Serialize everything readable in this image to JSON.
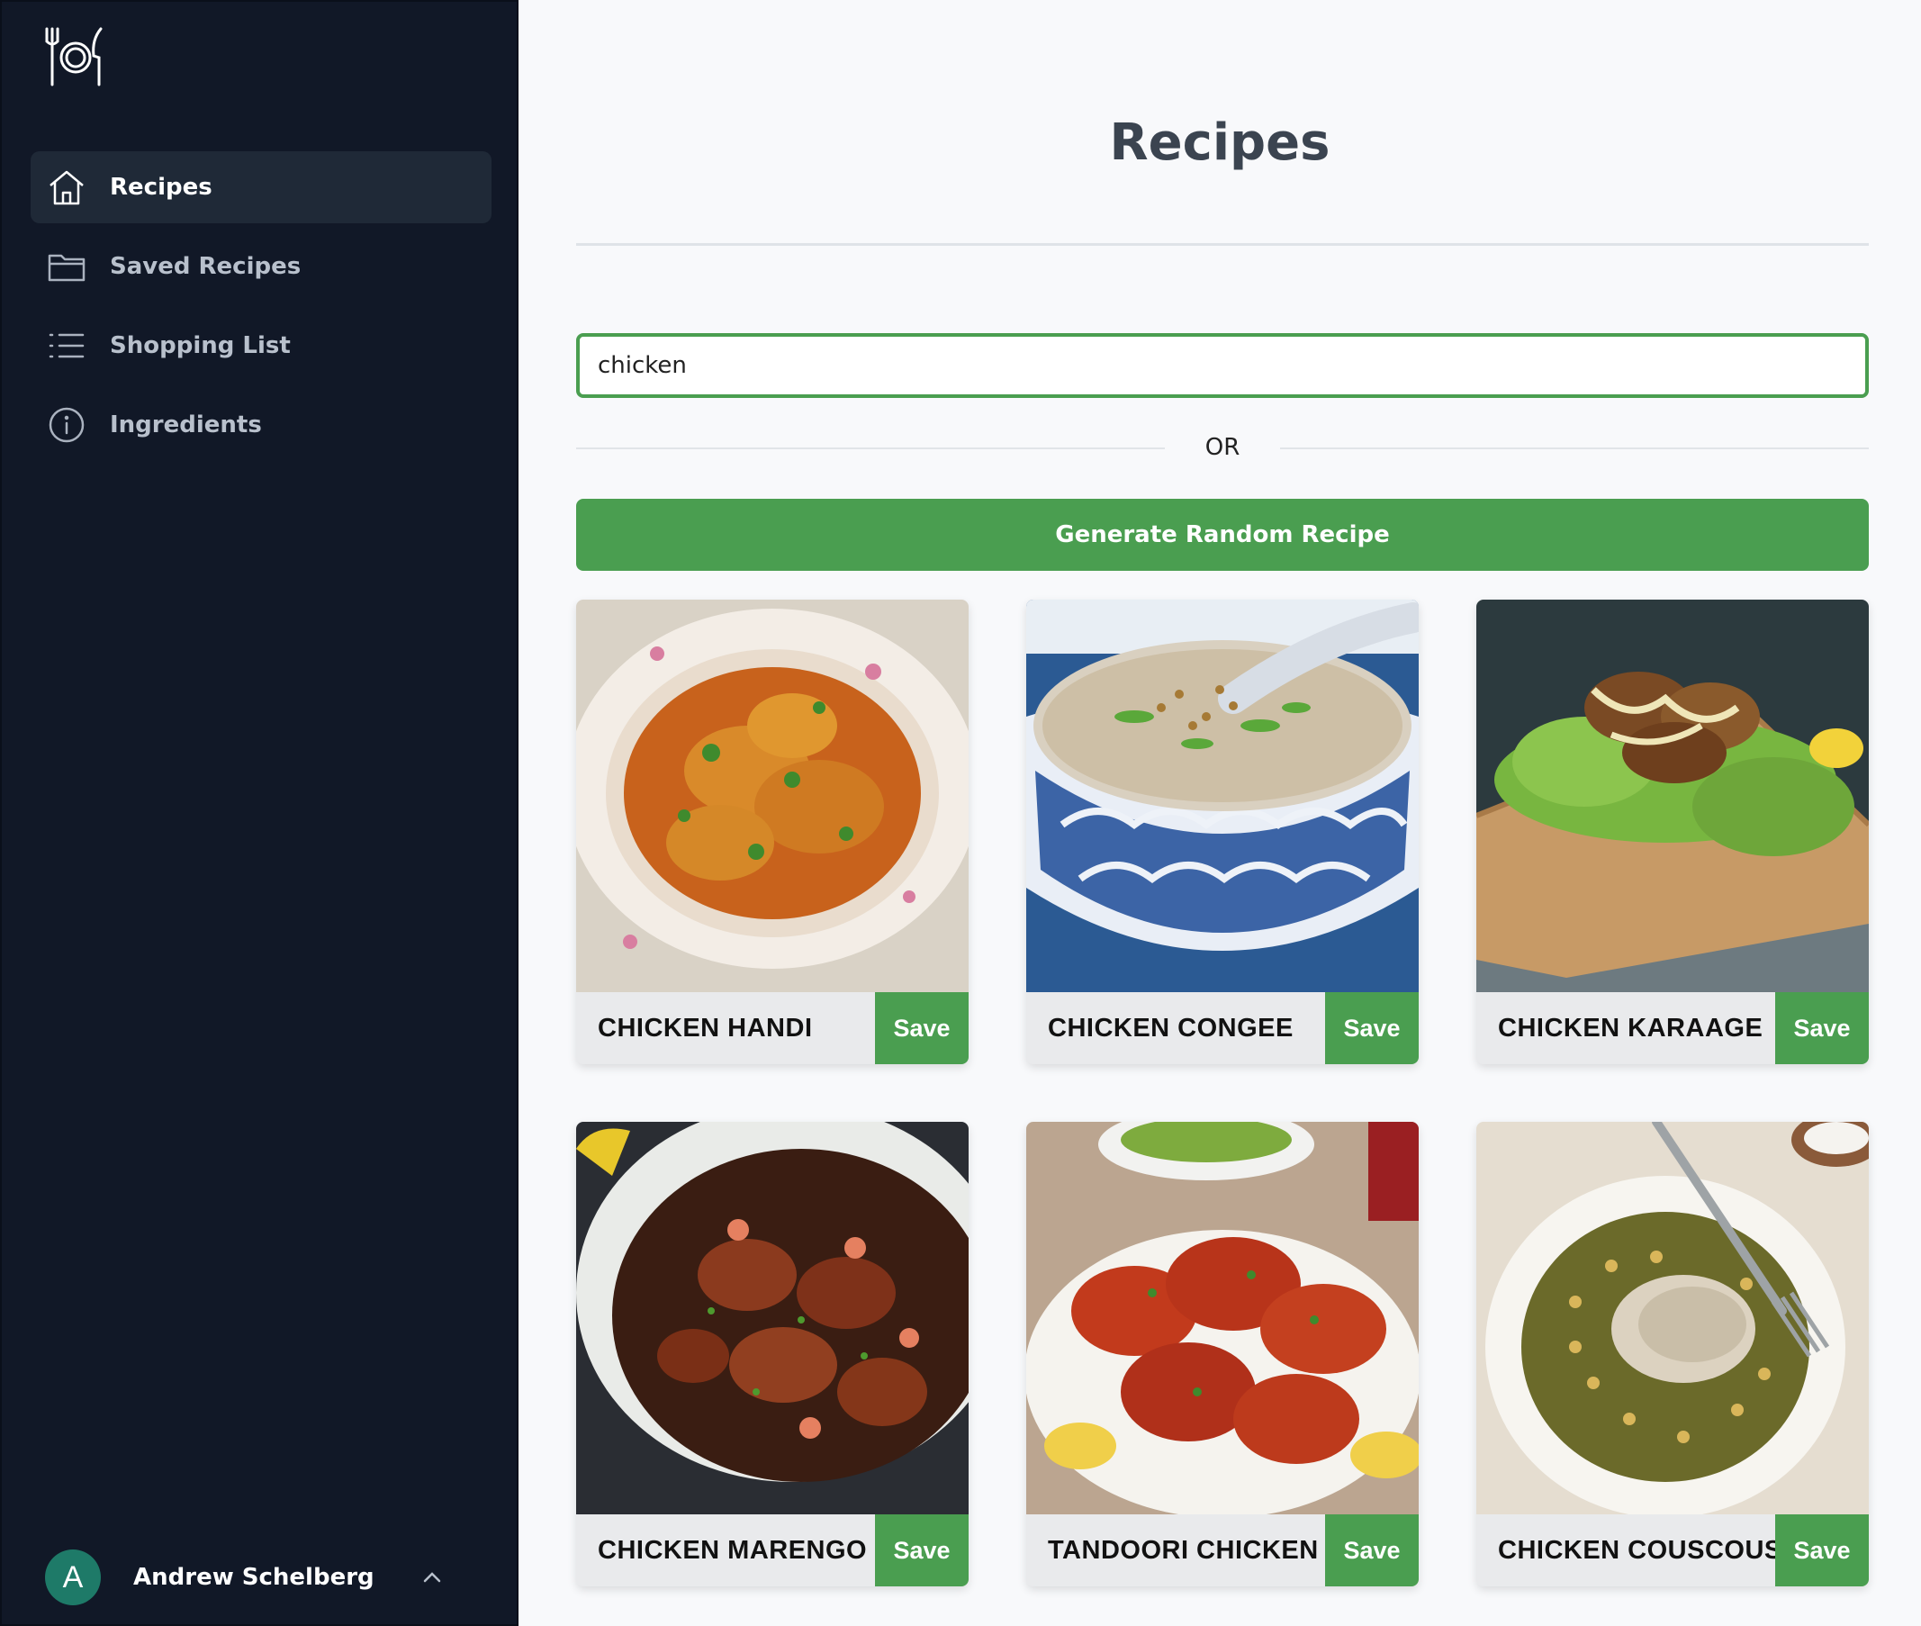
{
  "sidebar": {
    "logo_icon": "plate-fork-knife-icon",
    "items": [
      {
        "label": "Recipes",
        "icon": "home-icon",
        "active": true
      },
      {
        "label": "Saved Recipes",
        "icon": "folder-icon",
        "active": false
      },
      {
        "label": "Shopping List",
        "icon": "list-icon",
        "active": false
      },
      {
        "label": "Ingredients",
        "icon": "info-icon",
        "active": false
      }
    ],
    "user": {
      "initial": "A",
      "name": "Andrew Schelberg",
      "chevron": "chevron-up-icon"
    }
  },
  "main": {
    "title": "Recipes",
    "search": {
      "value": "chicken",
      "placeholder": ""
    },
    "divider_text": "OR",
    "generate_button": "Generate Random Recipe",
    "recipes": [
      {
        "title": "CHICKEN HANDI",
        "save_label": "Save"
      },
      {
        "title": "CHICKEN CONGEE",
        "save_label": "Save"
      },
      {
        "title": "CHICKEN KARAAGE",
        "save_label": "Save"
      },
      {
        "title": "CHICKEN MARENGO",
        "save_label": "Save"
      },
      {
        "title": "TANDOORI CHICKEN",
        "save_label": "Save"
      },
      {
        "title": "CHICKEN COUSCOUS",
        "save_label": "Save"
      }
    ]
  },
  "colors": {
    "sidebar_bg": "#111827",
    "active_item_bg": "#1f2937",
    "accent_green": "#4a9e50",
    "avatar_bg": "#1e7a68",
    "page_bg": "#f8f9fb"
  }
}
